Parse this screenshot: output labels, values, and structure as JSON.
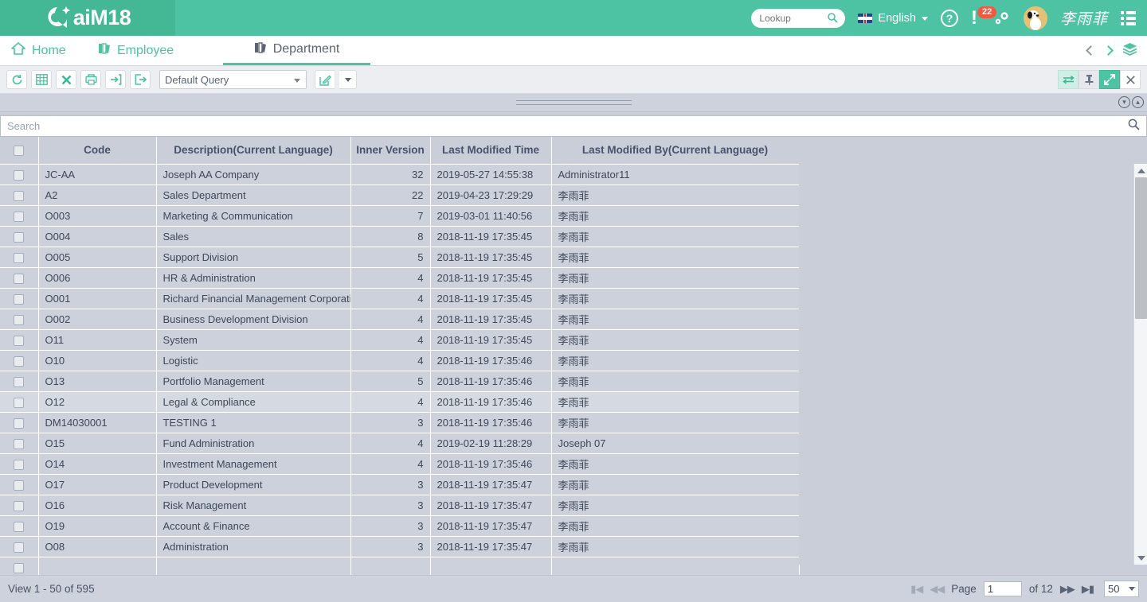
{
  "brand": {
    "name": "aiM18",
    "logo_icon": "aim18-logo-icon"
  },
  "header": {
    "lookup_placeholder": "Lookup",
    "lookup_value": "",
    "search_icon": "search-icon",
    "language": "English",
    "flag_icon": "uk-flag-icon",
    "help_icon": "help-icon",
    "help_label": "?",
    "alert_icon": "alert-icon",
    "alert_count": "22",
    "settings_icon": "gears-icon",
    "avatar_icon": "user-avatar",
    "username": "李雨菲",
    "menu_icon": "list-menu-icon"
  },
  "tabs": [
    {
      "label": "Home",
      "icon": "home-icon",
      "active": false
    },
    {
      "label": "Employee",
      "icon": "books-icon",
      "active": false
    },
    {
      "label": "Department",
      "icon": "books-icon",
      "active": true
    }
  ],
  "tab_nav": {
    "prev_icon": "chevron-left-icon",
    "next_icon": "chevron-right-icon",
    "layers_icon": "layers-icon"
  },
  "toolbar": {
    "buttons": [
      {
        "name": "refresh-button",
        "icon": "refresh-icon"
      },
      {
        "name": "grid-view-button",
        "icon": "table-grid-icon"
      },
      {
        "name": "delete-button",
        "icon": "close-x-icon"
      },
      {
        "name": "print-button",
        "icon": "printer-icon"
      },
      {
        "name": "import-button",
        "icon": "import-arrow-icon"
      },
      {
        "name": "export-button",
        "icon": "export-arrow-icon"
      }
    ],
    "query_value": "Default Query",
    "edit_query_icon": "edit-square-icon",
    "query_dropdown_icon": "caret-down-icon",
    "right_buttons": [
      {
        "name": "swap-panel-button",
        "icon": "swap-arrows-icon"
      },
      {
        "name": "pin-button",
        "icon": "pin-icon"
      },
      {
        "name": "maximize-button",
        "icon": "expand-arrows-icon"
      },
      {
        "name": "close-button",
        "icon": "close-x-icon"
      }
    ]
  },
  "panelbar": {
    "grip_icon": "drag-grip-icon",
    "collapse_icon": "chevron-down-circle-icon",
    "expand_icon": "collapse-circle-icon"
  },
  "search": {
    "placeholder": "Search",
    "value": "",
    "icon": "search-icon"
  },
  "grid": {
    "columns": [
      "Code",
      "Description(Current Language)",
      "Inner Version",
      "Last Modified Time",
      "Last Modified By(Current Language)"
    ],
    "rows": [
      {
        "code": "JC-AA",
        "desc": "Joseph AA Company",
        "ver": "32",
        "time": "2019-05-27 14:55:38",
        "by": "Administrator11"
      },
      {
        "code": "A2",
        "desc": "Sales Department",
        "ver": "22",
        "time": "2019-04-23 17:29:29",
        "by": "李雨菲"
      },
      {
        "code": "O003",
        "desc": "Marketing & Communication",
        "ver": "7",
        "time": "2019-03-01 11:40:56",
        "by": "李雨菲"
      },
      {
        "code": "O004",
        "desc": "Sales",
        "ver": "8",
        "time": "2018-11-19 17:35:45",
        "by": "李雨菲"
      },
      {
        "code": "O005",
        "desc": "Support Division",
        "ver": "5",
        "time": "2018-11-19 17:35:45",
        "by": "李雨菲"
      },
      {
        "code": "O006",
        "desc": "HR & Administration",
        "ver": "4",
        "time": "2018-11-19 17:35:45",
        "by": "李雨菲"
      },
      {
        "code": "O001",
        "desc": "Richard Financial Management Corporati",
        "ver": "4",
        "time": "2018-11-19 17:35:45",
        "by": "李雨菲"
      },
      {
        "code": "O002",
        "desc": "Business Development Division",
        "ver": "4",
        "time": "2018-11-19 17:35:45",
        "by": "李雨菲"
      },
      {
        "code": "O11",
        "desc": "System",
        "ver": "4",
        "time": "2018-11-19 17:35:45",
        "by": "李雨菲"
      },
      {
        "code": "O10",
        "desc": "Logistic",
        "ver": "4",
        "time": "2018-11-19 17:35:46",
        "by": "李雨菲"
      },
      {
        "code": "O13",
        "desc": "Portfolio Management",
        "ver": "5",
        "time": "2018-11-19 17:35:46",
        "by": "李雨菲"
      },
      {
        "code": "O12",
        "desc": "Legal & Compliance",
        "ver": "4",
        "time": "2018-11-19 17:35:46",
        "by": "李雨菲",
        "highlight": true
      },
      {
        "code": "DM14030001",
        "desc": "TESTING 1",
        "ver": "3",
        "time": "2018-11-19 17:35:46",
        "by": "李雨菲"
      },
      {
        "code": "O15",
        "desc": "Fund Administration",
        "ver": "4",
        "time": "2019-02-19 11:28:29",
        "by": "Joseph 07"
      },
      {
        "code": "O14",
        "desc": "Investment Management",
        "ver": "4",
        "time": "2018-11-19 17:35:46",
        "by": "李雨菲"
      },
      {
        "code": "O17",
        "desc": "Product Development",
        "ver": "3",
        "time": "2018-11-19 17:35:47",
        "by": "李雨菲"
      },
      {
        "code": "O16",
        "desc": "Risk Management",
        "ver": "3",
        "time": "2018-11-19 17:35:47",
        "by": "李雨菲"
      },
      {
        "code": "O19",
        "desc": "Account & Finance",
        "ver": "3",
        "time": "2018-11-19 17:35:47",
        "by": "李雨菲"
      },
      {
        "code": "O08",
        "desc": "Administration",
        "ver": "3",
        "time": "2018-11-19 17:35:47",
        "by": "李雨菲"
      },
      {
        "code": "",
        "desc": "",
        "ver": "",
        "time": "",
        "by": ""
      }
    ]
  },
  "scrollbar": {
    "up_icon": "scroll-up-arrow",
    "down_icon": "scroll-down-arrow",
    "thumb": "scroll-thumb"
  },
  "footer": {
    "view_count": "View 1 - 50 of 595",
    "first_icon": "first-page-icon",
    "prev_icon": "prev-page-icon",
    "page_label": "Page",
    "page_value": "1",
    "of_label": "of 12",
    "next_icon": "next-page-icon",
    "last_icon": "last-page-icon",
    "page_size": "50"
  },
  "colors": {
    "brand_green": "#4ec3a3",
    "logo_green": "#44b795",
    "badge_red": "#f05a41",
    "grid_bg": "#c9ced9",
    "row_bg": "#ccd1db"
  }
}
